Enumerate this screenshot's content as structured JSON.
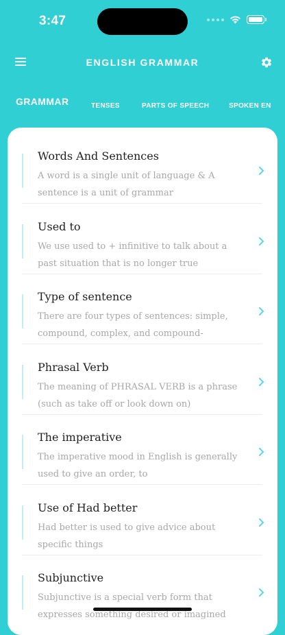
{
  "status": {
    "time": "3:47"
  },
  "header": {
    "title": "ENGLISH GRAMMAR"
  },
  "tabs": [
    {
      "label": "GRAMMAR",
      "active": true
    },
    {
      "label": "TENSES",
      "active": false
    },
    {
      "label": "PARTS OF SPEECH",
      "active": false
    },
    {
      "label": "SPOKEN EN",
      "active": false
    }
  ],
  "topics": [
    {
      "title": "Words And Sentences",
      "description": "A word is a single unit of language & A sentence is a unit of grammar"
    },
    {
      "title": "Used to",
      "description": "We use used to + infinitive to talk about a past situation that is no longer true"
    },
    {
      "title": "Type of sentence",
      "description": "There are four types of sentences: simple, compound, complex, and compound-"
    },
    {
      "title": "Phrasal Verb",
      "description": "The meaning of PHRASAL VERB is a phrase (such as take off or look down on)"
    },
    {
      "title": "The imperative",
      "description": "The imperative mood in English is generally used to give an order, to"
    },
    {
      "title": "Use of Had better",
      "description": "Had better is used to give advice about specific things"
    },
    {
      "title": "Subjunctive",
      "description": "Subjunctive is a special verb form that expresses something desired or imagined"
    }
  ],
  "icons": {
    "menu": "hamburger-icon",
    "settings": "gear-icon",
    "chevron": "chevron-right-icon"
  },
  "colors": {
    "background": "#2fcfd3",
    "accent": "#5ed3e3",
    "card": "#ffffff"
  }
}
